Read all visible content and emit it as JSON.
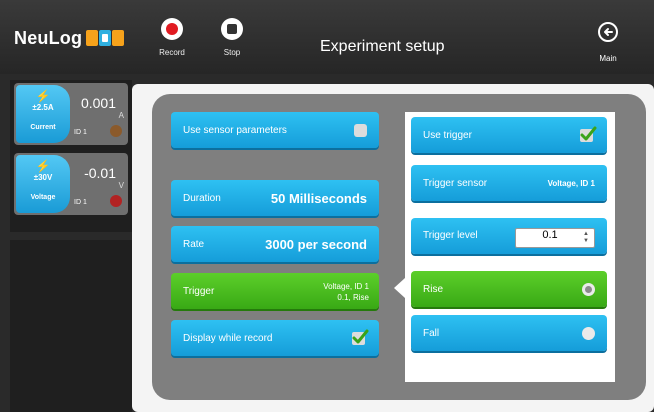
{
  "app": {
    "logo_text": "NeuLog",
    "page_title": "Experiment setup"
  },
  "toolbar": {
    "record_label": "Record",
    "stop_label": "Stop",
    "main_label": "Main"
  },
  "sensors": [
    {
      "icon": "lightning-icon",
      "range": "±2.5A",
      "name": "Current",
      "value": "0.001",
      "unit": "A",
      "id": "ID 1",
      "color": "#8b5a2b"
    },
    {
      "icon": "lightning-icon",
      "range": "±30V",
      "name": "Voltage",
      "value": "-0.01",
      "unit": "V",
      "id": "ID 1",
      "color": "#b22222"
    }
  ],
  "settings": {
    "use_sensor_params": "Use sensor parameters",
    "duration_label": "Duration",
    "duration_value": "50 Milliseconds",
    "rate_label": "Rate",
    "rate_value": "3000 per second",
    "trigger_label": "Trigger",
    "trigger_value_line1": "Voltage, ID 1",
    "trigger_value_line2": "0.1, Rise",
    "display_label": "Display while record",
    "display_checked": true
  },
  "trigger_panel": {
    "use_trigger_label": "Use trigger",
    "use_trigger_checked": true,
    "sensor_label": "Trigger sensor",
    "sensor_value": "Voltage, ID 1",
    "level_label": "Trigger level",
    "level_value": "0.1",
    "rise_label": "Rise",
    "fall_label": "Fall",
    "selected": "Rise"
  },
  "colors": {
    "accent_blue": "#1aa3dd",
    "accent_green": "#43b11c",
    "record_red": "#e11b22"
  }
}
